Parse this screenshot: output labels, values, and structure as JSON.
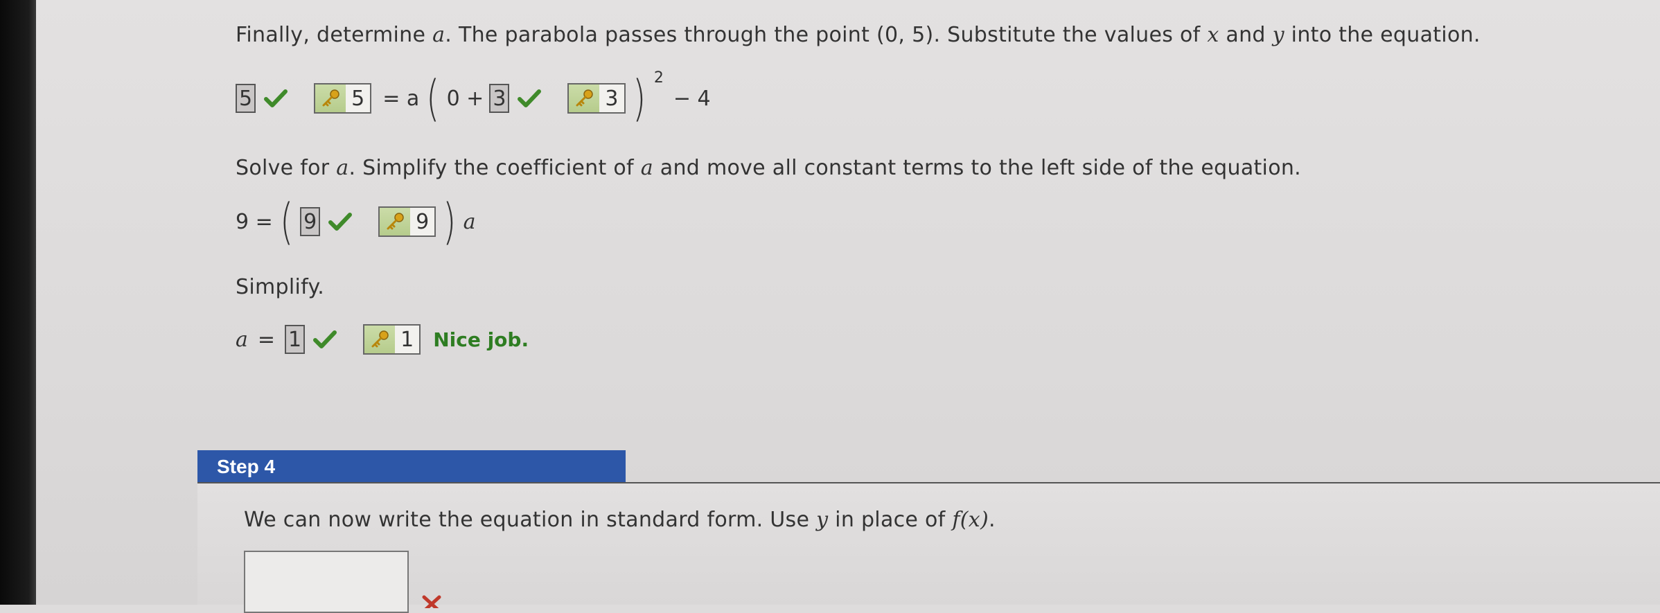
{
  "instructions": {
    "determine_a": {
      "before": "Finally, determine ",
      "var": "a",
      "middle": ". The parabola passes through the point (0, 5). Substitute the values of ",
      "x": "x",
      "and": " and ",
      "y": "y",
      "after": " into the equation."
    },
    "solve_for_a": {
      "before": "Solve for ",
      "var1": "a",
      "middle": ". Simplify the coefficient of ",
      "var2": "a",
      "after": " and move all constant terms to the left side of the equation."
    },
    "simplify": "Simplify."
  },
  "equation1": {
    "answer1": "5",
    "key1": "5",
    "equals_a": "= a",
    "zero_plus": "0 +",
    "answer2": "3",
    "key2": "3",
    "exponent": "2",
    "minus_four": "− 4"
  },
  "equation2": {
    "lhs": "9 =",
    "answer": "9",
    "key": "9",
    "trailing_var": "a"
  },
  "equation3": {
    "lhs_var": "a",
    "equals": "=",
    "answer": "1",
    "key": "1",
    "feedback": "Nice job."
  },
  "step4": {
    "title": "Step 4",
    "text_before": "We can now write the equation in standard form. Use ",
    "var_y": "y",
    "text_mid": " in place of ",
    "fx": "f(x)",
    "text_after": "."
  },
  "colors": {
    "correct_green": "#3f8a2a",
    "step_blue": "#2d57a8",
    "incorrect_red": "#c0392b"
  }
}
